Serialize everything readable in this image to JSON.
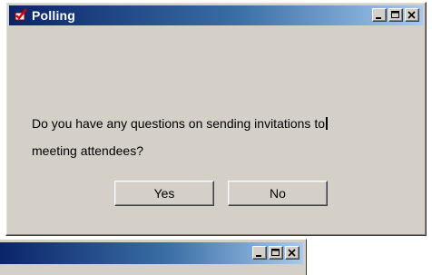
{
  "dialog": {
    "title": "Polling",
    "title_icon": "checkmark-app-icon",
    "caption_buttons": [
      "minimize",
      "maximize",
      "close"
    ],
    "message_line1": "Do you have any questions on sending invitations to",
    "message_line2": "meeting attendees?",
    "buttons": {
      "yes_label": "Yes",
      "no_label": "No"
    }
  },
  "background_window": {
    "caption_buttons": [
      "minimize",
      "maximize",
      "close"
    ]
  },
  "colors": {
    "face": "#d4d0c8",
    "title_active_start": "#0a246a",
    "title_active_end": "#a6caf0"
  }
}
